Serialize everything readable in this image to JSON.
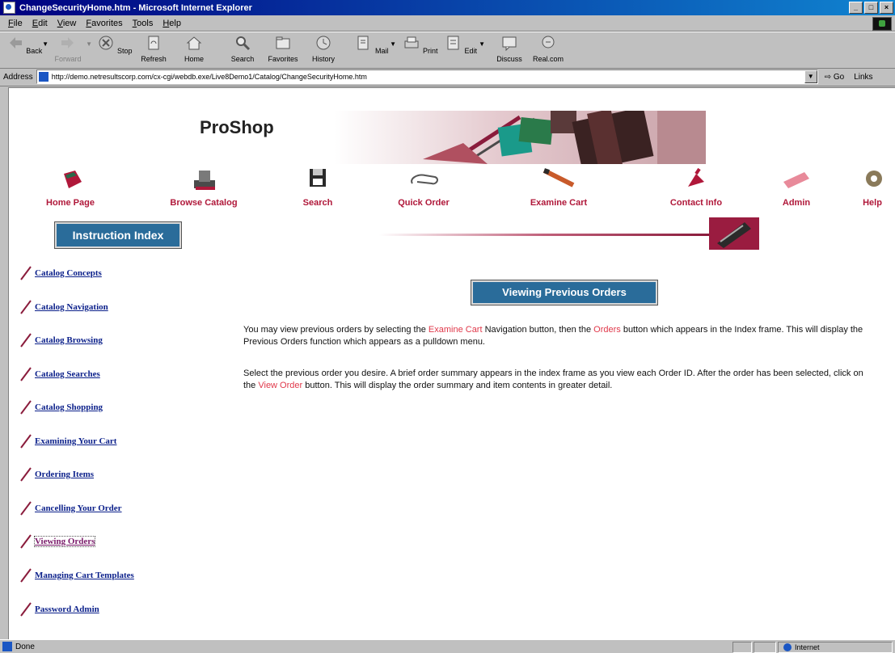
{
  "window": {
    "title": "ChangeSecurityHome.htm - Microsoft Internet Explorer",
    "min": "_",
    "max": "□",
    "close": "×"
  },
  "menubar": [
    "File",
    "Edit",
    "View",
    "Favorites",
    "Tools",
    "Help"
  ],
  "toolbar": {
    "back": "Back",
    "forward": "Forward",
    "stop": "Stop",
    "refresh": "Refresh",
    "home": "Home",
    "search": "Search",
    "favorites": "Favorites",
    "history": "History",
    "mail": "Mail",
    "print": "Print",
    "edit": "Edit",
    "discuss": "Discuss",
    "realcom": "Real.com"
  },
  "address": {
    "label": "Address",
    "url": "http://demo.netresultscorp.com/cx-cgi/webdb.exe/Live8Demo1/Catalog/ChangeSecurityHome.htm",
    "go": "Go",
    "links": "Links"
  },
  "page": {
    "banner_title": "ProShop",
    "nav": [
      "Home Page",
      "Browse Catalog",
      "Search",
      "Quick Order",
      "Examine Cart",
      "Contact Info",
      "Admin",
      "Help"
    ],
    "instruction_index": "Instruction Index",
    "side_links": [
      "Catalog Concepts",
      "Catalog Navigation",
      "Catalog Browsing",
      "Catalog Searches",
      "Catalog Shopping",
      "Examining Your Cart",
      "Ordering Items",
      "Cancelling Your Order",
      "Viewing Orders",
      "Managing Cart Templates",
      "Password Admin"
    ],
    "section_title": "Viewing Previous Orders",
    "para1": {
      "a": "You may view previous orders by selecting the ",
      "h1": "Examine Cart",
      "b": " Navigation button, then the ",
      "h2": "Orders",
      "c": " button which appears in the Index frame. This will display the Previous Orders function which appears as a pulldown menu."
    },
    "para2": {
      "a": "Select the previous order you desire. A brief order summary appears in the index frame as you view each Order ID. After the order has been selected, click on the ",
      "h1": "View Order",
      "b": " button. This will display the order summary and item contents in greater detail."
    }
  },
  "status": {
    "text": "Done",
    "zone": "Internet"
  },
  "colors": {
    "nav_text": "#b0183a",
    "link": "#0a1f8a",
    "visited": "#7a1a6a",
    "highlight": "#e0384a",
    "badge": "#2a6c9a"
  }
}
